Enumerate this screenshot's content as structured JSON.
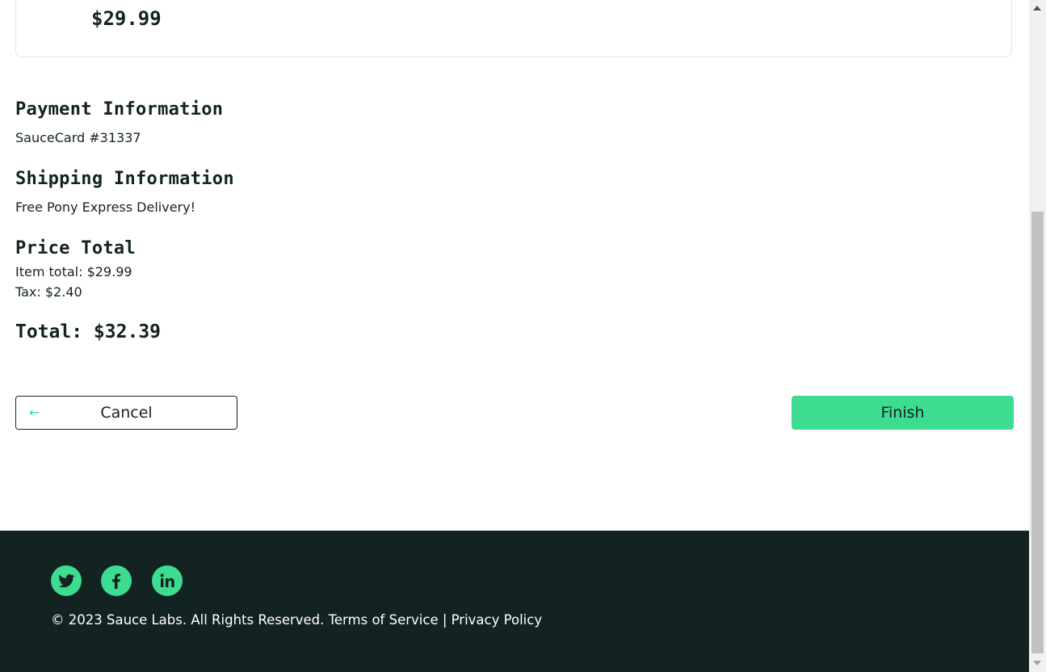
{
  "cart_item": {
    "price": "$29.99"
  },
  "summary": {
    "payment_title": "Payment Information",
    "payment_value": "SauceCard #31337",
    "shipping_title": "Shipping Information",
    "shipping_value": "Free Pony Express Delivery!",
    "price_title": "Price Total",
    "item_total": "Item total: $29.99",
    "tax": "Tax: $2.40",
    "total": "Total: $32.39"
  },
  "actions": {
    "cancel_label": "Cancel",
    "finish_label": "Finish"
  },
  "footer": {
    "social": [
      "twitter-icon",
      "facebook-icon",
      "linkedin-icon"
    ],
    "copyright": "© 2023 Sauce Labs. All Rights Reserved. Terms of Service | Privacy Policy"
  },
  "colors": {
    "accent": "#3ddc91",
    "dark": "#132322"
  }
}
